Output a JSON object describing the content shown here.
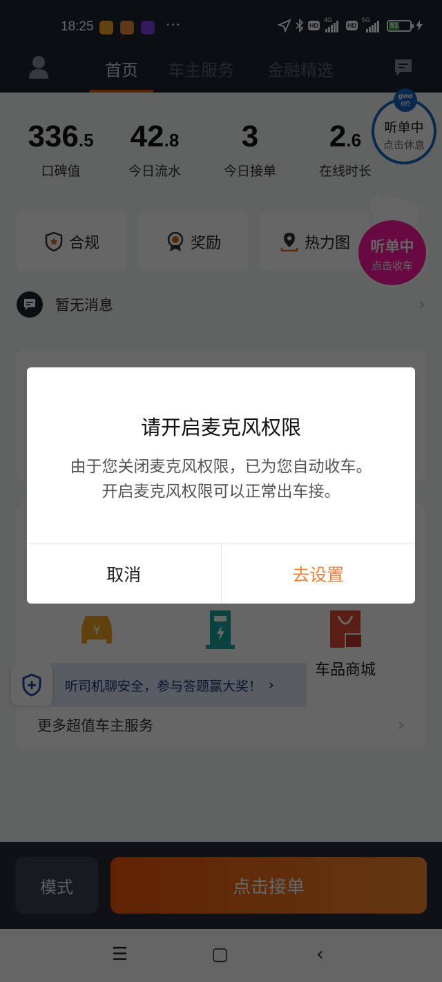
{
  "status_bar": {
    "time": "18:25",
    "more": "···",
    "network_1": "4G",
    "network_2": "5G",
    "hd": "HD",
    "battery": "51",
    "battery_percent": 51
  },
  "nav": {
    "tabs": [
      {
        "label": "首页",
        "active": true
      },
      {
        "label": "车主服务",
        "active": false
      },
      {
        "label": "金融精选",
        "active": false
      }
    ]
  },
  "stats": [
    {
      "int": "336",
      "dec": ".5",
      "label": "口碑值"
    },
    {
      "int": "42",
      "dec": ".8",
      "label": "今日流水"
    },
    {
      "int": "3",
      "dec": "",
      "label": "今日接单"
    },
    {
      "int": "2",
      "dec": ".6",
      "label": "在线时长"
    }
  ],
  "quick_links": [
    {
      "label": "合规",
      "icon": "shield-star-icon"
    },
    {
      "label": "奖励",
      "icon": "medal-icon"
    },
    {
      "label": "热力图",
      "icon": "location-pin-icon"
    }
  ],
  "messages": {
    "text": "暂无消息"
  },
  "float_listen": {
    "logo_top": "goo",
    "logo_bottom": "出行",
    "title": "听单中",
    "subtitle": "点击休息"
  },
  "float_pink": {
    "title": "听单中",
    "subtitle": "点击收车"
  },
  "services": [
    {
      "label": "",
      "icon": "car-yuan-icon",
      "color": "#f0a020"
    },
    {
      "label": "",
      "icon": "charging-station-icon",
      "color": "#1aa6a0"
    },
    {
      "label": "车品商城",
      "icon": "shopping-bag-icon",
      "color": "#e04b3a"
    }
  ],
  "safety_banner": {
    "text": "听司机聊安全，参与答题赢大奖！",
    "arrow": "›"
  },
  "more_services": {
    "label": "更多超值车主服务"
  },
  "bottom": {
    "mode_label": "模式",
    "accept_label": "点击接单"
  },
  "dialog": {
    "title": "请开启麦克风权限",
    "body": "由于您关闭麦克风权限，已为您自动收车。开启麦克风权限可以正常出车接。",
    "cancel": "取消",
    "confirm": "去设置",
    "confirm_color": "#ef7e36"
  },
  "system_nav": {
    "menu": "☰",
    "home": "▢",
    "back": "‹"
  }
}
